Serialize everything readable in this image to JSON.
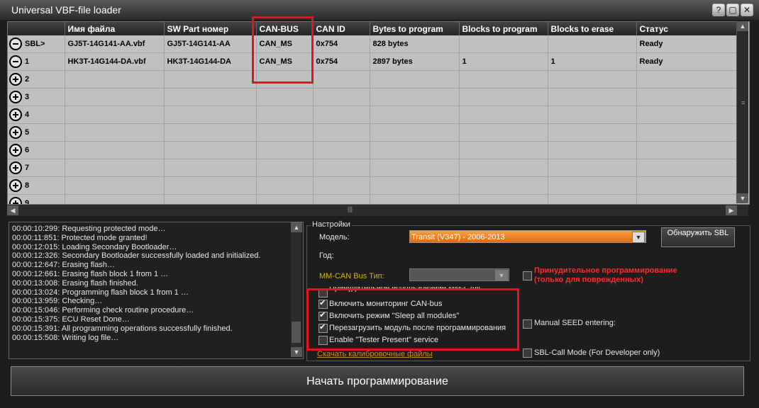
{
  "window": {
    "title": "Universal VBF-file loader",
    "controls": [
      "?",
      "▢",
      "✕"
    ]
  },
  "grid": {
    "columns": [
      "",
      "Имя файла",
      "SW Part номер",
      "CAN-BUS",
      "CAN ID",
      "Bytes to program",
      "Blocks to program",
      "Blocks to erase",
      "Статус"
    ],
    "rows": [
      {
        "icon": "minus",
        "label": "SBL>",
        "file": "GJ5T-14G141-AA.vbf",
        "sw_part": "GJ5T-14G141-AA",
        "can_bus": "CAN_MS",
        "can_id": "0x754",
        "bytes": "828 bytes",
        "blocks_program": "",
        "blocks_erase": "",
        "status": "Ready"
      },
      {
        "icon": "minus",
        "label": "1",
        "file": "HK3T-14G144-DA.vbf",
        "sw_part": "HK3T-14G144-DA",
        "can_bus": "CAN_MS",
        "can_id": "0x754",
        "bytes": "2897 bytes",
        "blocks_program": "1",
        "blocks_erase": "1",
        "status": "Ready"
      },
      {
        "icon": "plus",
        "label": "2",
        "file": "",
        "sw_part": "",
        "can_bus": "",
        "can_id": "",
        "bytes": "",
        "blocks_program": "",
        "blocks_erase": "",
        "status": ""
      },
      {
        "icon": "plus",
        "label": "3",
        "file": "",
        "sw_part": "",
        "can_bus": "",
        "can_id": "",
        "bytes": "",
        "blocks_program": "",
        "blocks_erase": "",
        "status": ""
      },
      {
        "icon": "plus",
        "label": "4",
        "file": "",
        "sw_part": "",
        "can_bus": "",
        "can_id": "",
        "bytes": "",
        "blocks_program": "",
        "blocks_erase": "",
        "status": ""
      },
      {
        "icon": "plus",
        "label": "5",
        "file": "",
        "sw_part": "",
        "can_bus": "",
        "can_id": "",
        "bytes": "",
        "blocks_program": "",
        "blocks_erase": "",
        "status": ""
      },
      {
        "icon": "plus",
        "label": "6",
        "file": "",
        "sw_part": "",
        "can_bus": "",
        "can_id": "",
        "bytes": "",
        "blocks_program": "",
        "blocks_erase": "",
        "status": ""
      },
      {
        "icon": "plus",
        "label": "7",
        "file": "",
        "sw_part": "",
        "can_bus": "",
        "can_id": "",
        "bytes": "",
        "blocks_program": "",
        "blocks_erase": "",
        "status": ""
      },
      {
        "icon": "plus",
        "label": "8",
        "file": "",
        "sw_part": "",
        "can_bus": "",
        "can_id": "",
        "bytes": "",
        "blocks_program": "",
        "blocks_erase": "",
        "status": ""
      },
      {
        "icon": "plus",
        "label": "9",
        "file": "",
        "sw_part": "",
        "can_bus": "",
        "can_id": "",
        "bytes": "",
        "blocks_program": "",
        "blocks_erase": "",
        "status": ""
      }
    ]
  },
  "log": {
    "lines": [
      "00:00:10:299: Requesting protected mode…",
      "00:00:11:851: Protected mode granted!",
      "00:00:12:015: Loading Secondary Bootloader…",
      "00:00:12:326: Secondary Bootloader successfully loaded and initialized.",
      "00:00:12:647: Erasing flash…",
      "00:00:12:661: Erasing flash block 1 from 1 …",
      "00:00:13:008: Erasing flash finished.",
      "00:00:13:024: Programming flash block 1 from 1 …",
      "00:00:13:959: Checking…",
      "00:00:15:046: Performing check routine procedure…",
      "00:00:15:375: ECU Reset Done…",
      "00:00:15:391: All programming operations successfully finished.",
      "00:00:15:508: Writing log file…"
    ]
  },
  "settings": {
    "title": "Настройки",
    "model_label": "Модель:",
    "model_value": "Transit (V347) - 2006-2013",
    "year_label": "Год:",
    "bus_type_label": "MM-CAN Bus Тип:",
    "detect_sbl_label": "Обнаружить SBL",
    "forced_program_line1": "Принудительное программирование",
    "forced_program_line2": "(только для поврежденных)",
    "forced_mmcan_label": "Принудительное использование MM-CAN",
    "monitor_can_label": "Включить мониторинг CAN-bus",
    "sleep_all_label": "Включить режим \"Sleep all modules\"",
    "reboot_label": "Перезагрузить модуль после программирования",
    "tester_present_label": "Enable \"Tester Present\" service",
    "download_link": "Скачать калибровочные файлы",
    "manual_seed_label": "Manual SEED entering:",
    "sbl_call_label": "SBL-Call Mode (For Developer only)"
  },
  "start_button_label": "Начать программирование",
  "colors": {
    "annotation_red": "#e3131f",
    "model_orange": "#f08a2a",
    "warning_red": "#ff2a2a",
    "link_orange": "#d58a10"
  }
}
